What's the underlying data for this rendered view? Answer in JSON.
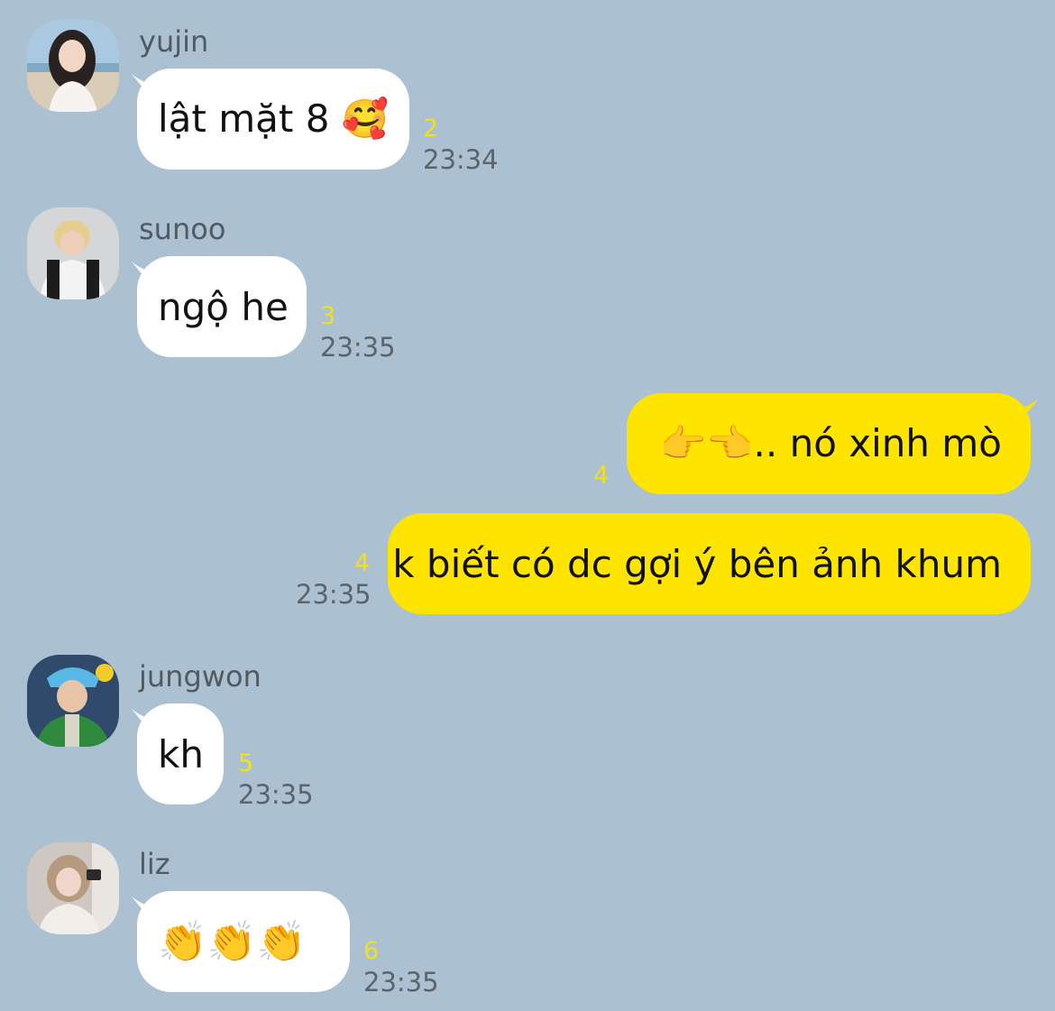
{
  "messages": [
    {
      "sender": "yujin",
      "text": "lật mặt 8 🥰",
      "unread": "2",
      "time": "23:34"
    },
    {
      "sender": "sunoo",
      "text": "ngộ he",
      "unread": "3",
      "time": "23:35"
    },
    {
      "sender": "me",
      "text": "👉👈.. nó xinh mò",
      "unread": "4"
    },
    {
      "sender": "me",
      "text": "k biết có dc gợi ý bên ảnh khum",
      "unread": "4",
      "time": "23:35"
    },
    {
      "sender": "jungwon",
      "text": "kh",
      "unread": "5",
      "time": "23:35"
    },
    {
      "sender": "liz",
      "text": "👏👏👏",
      "unread": "6",
      "time": "23:35"
    }
  ],
  "colors": {
    "background": "#abc1d1",
    "incoming_bubble": "#ffffff",
    "outgoing_bubble": "#fee500",
    "unread_count": "#f4e016"
  }
}
